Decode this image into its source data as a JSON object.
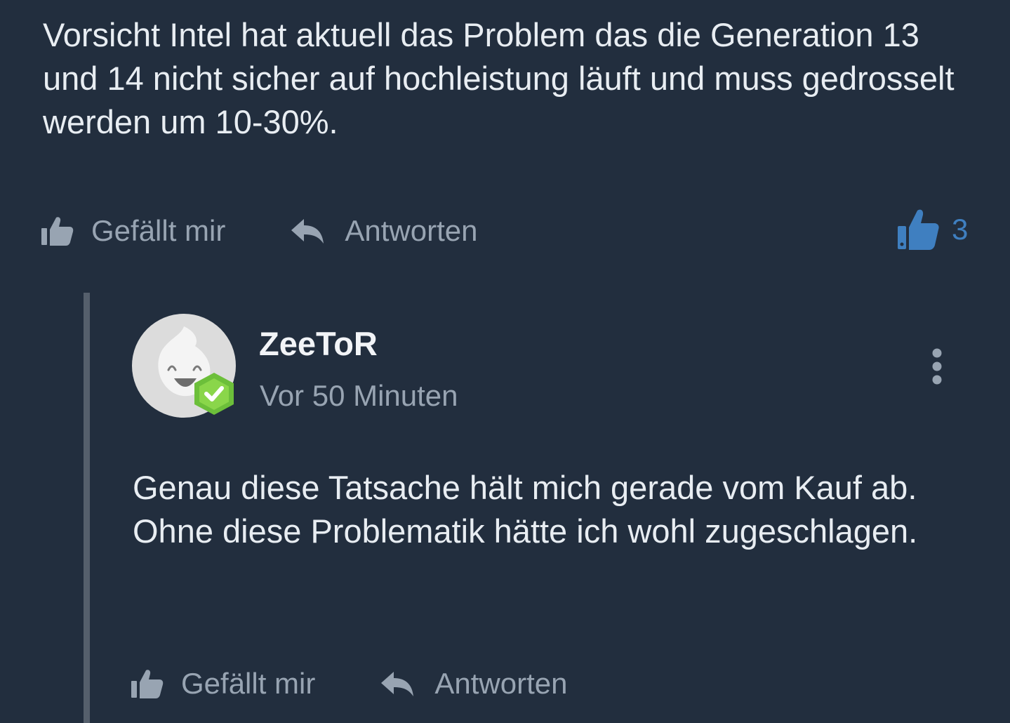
{
  "main_comment": {
    "text": "Vorsicht Intel hat aktuell das Problem das die Generation 13 und 14 nicht sicher auf hochleistung läuft und muss gedrosselt werden um 10-30%.",
    "actions": {
      "like_label": "Gefällt mir",
      "reply_label": "Antworten"
    },
    "like_count": "3"
  },
  "reply": {
    "username": "ZeeToR",
    "timestamp": "Vor 50 Minuten",
    "text": "Genau diese Tatsache hält mich gerade vom Kauf ab. Ohne diese Problematik hätte ich wohl zugeschlagen.",
    "actions": {
      "like_label": "Gefällt mir",
      "reply_label": "Antworten"
    }
  },
  "icons": {
    "like": "thumbs-up-icon",
    "reply": "reply-arrow-icon",
    "liked_count": "thumbs-up-filled-icon",
    "verified": "verified-check-badge-icon",
    "more": "more-vertical-icon"
  },
  "colors": {
    "background": "#222e3e",
    "text": "#e8edf2",
    "muted": "#98a4b2",
    "accent_blue": "#3f7fc0",
    "verified_green": "#6cbf3a",
    "thread_line": "#555f6c"
  }
}
